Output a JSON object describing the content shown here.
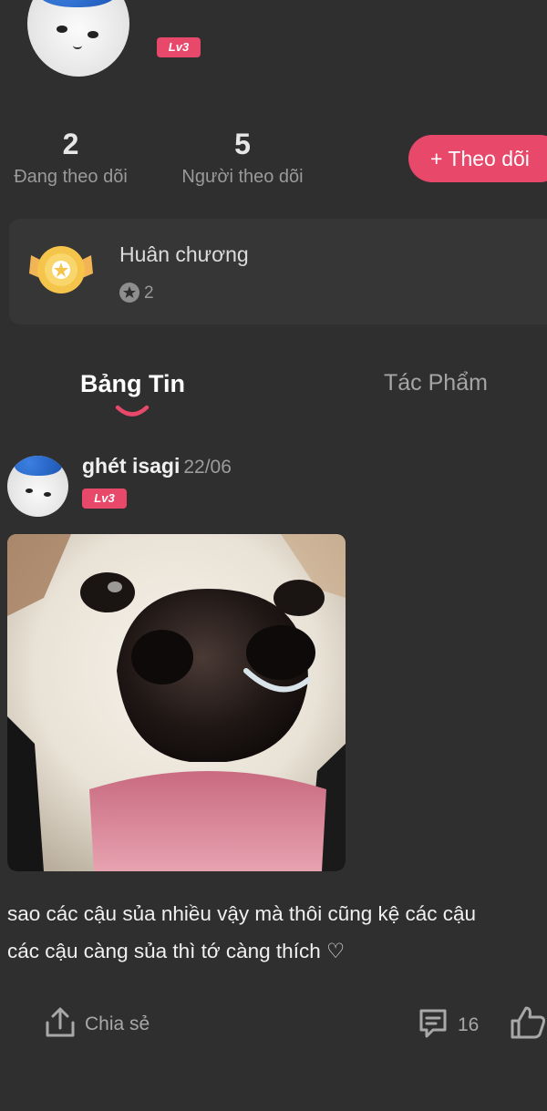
{
  "profile": {
    "level_badge": "Lv3",
    "stats": [
      {
        "value": "2",
        "label": "Đang theo dõi"
      },
      {
        "value": "5",
        "label": "Người theo dõi"
      }
    ],
    "follow_button": "+ Theo dõi"
  },
  "medal": {
    "title": "Huân chương",
    "count": "2"
  },
  "tabs": [
    {
      "label": "Bảng Tin",
      "active": true
    },
    {
      "label": "Tác Phẩm",
      "active": false
    }
  ],
  "post": {
    "username": "ghét isagi",
    "date": "22/06",
    "level_badge": "Lv3",
    "text": "sao các cậu sủa nhiều vậy mà thôi cũng kệ các cậu\ncác cậu càng sủa thì tớ càng thích ♡",
    "share_label": "Chia sẻ",
    "comment_count": "16"
  },
  "colors": {
    "background": "#2f2f2f",
    "accent": "#e8486a",
    "card": "#363636"
  }
}
